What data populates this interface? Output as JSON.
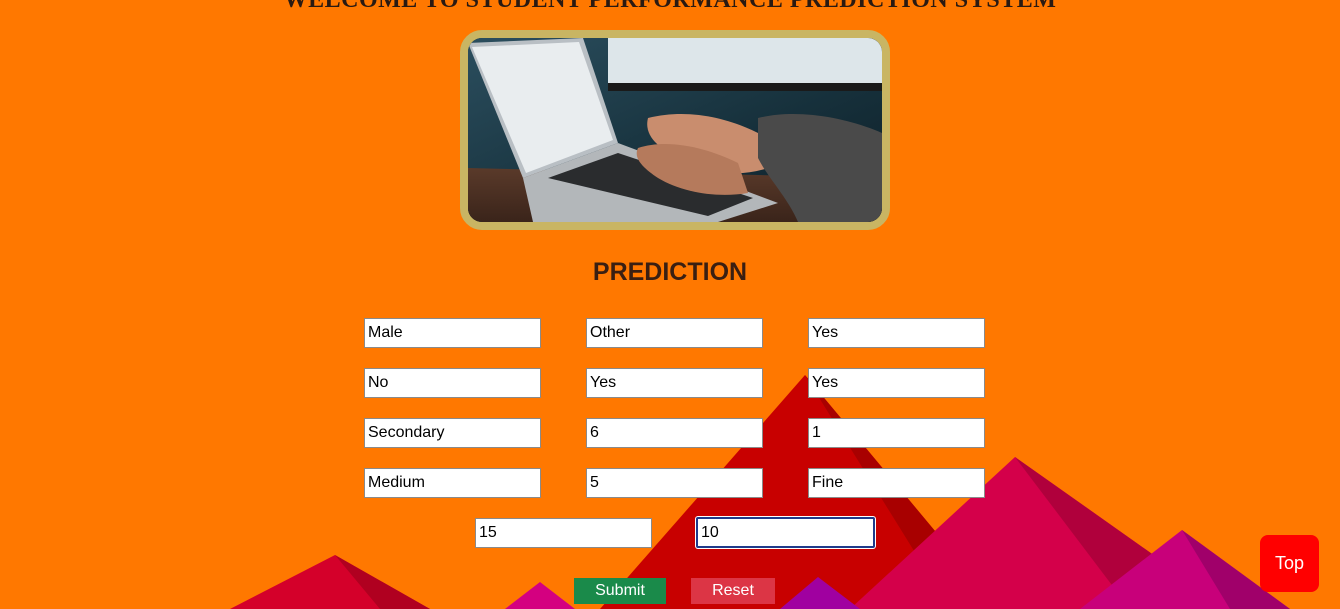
{
  "header": {
    "title": "WELCOME TO STUDENT PERFORMANCE PREDICTION SYSTEM"
  },
  "hero": {
    "image_subject": "hands typing on a laptop keyboard"
  },
  "prediction": {
    "title": "PREDICTION",
    "fields": [
      {
        "value": "Male"
      },
      {
        "value": "Other"
      },
      {
        "value": "Yes"
      },
      {
        "value": "No"
      },
      {
        "value": "Yes"
      },
      {
        "value": "Yes"
      },
      {
        "value": "Secondary"
      },
      {
        "value": "6"
      },
      {
        "value": "1"
      },
      {
        "value": "Medium"
      },
      {
        "value": "5"
      },
      {
        "value": "Fine"
      },
      {
        "value": "15"
      },
      {
        "value": "10"
      }
    ]
  },
  "buttons": {
    "submit_label": "Submit",
    "reset_label": "Reset",
    "top_label": "Top"
  },
  "colors": {
    "background": "#ff7800",
    "frame": "#c9b563",
    "submit": "#1a8a4a",
    "reset": "#dc3545",
    "top": "#ff0000"
  }
}
